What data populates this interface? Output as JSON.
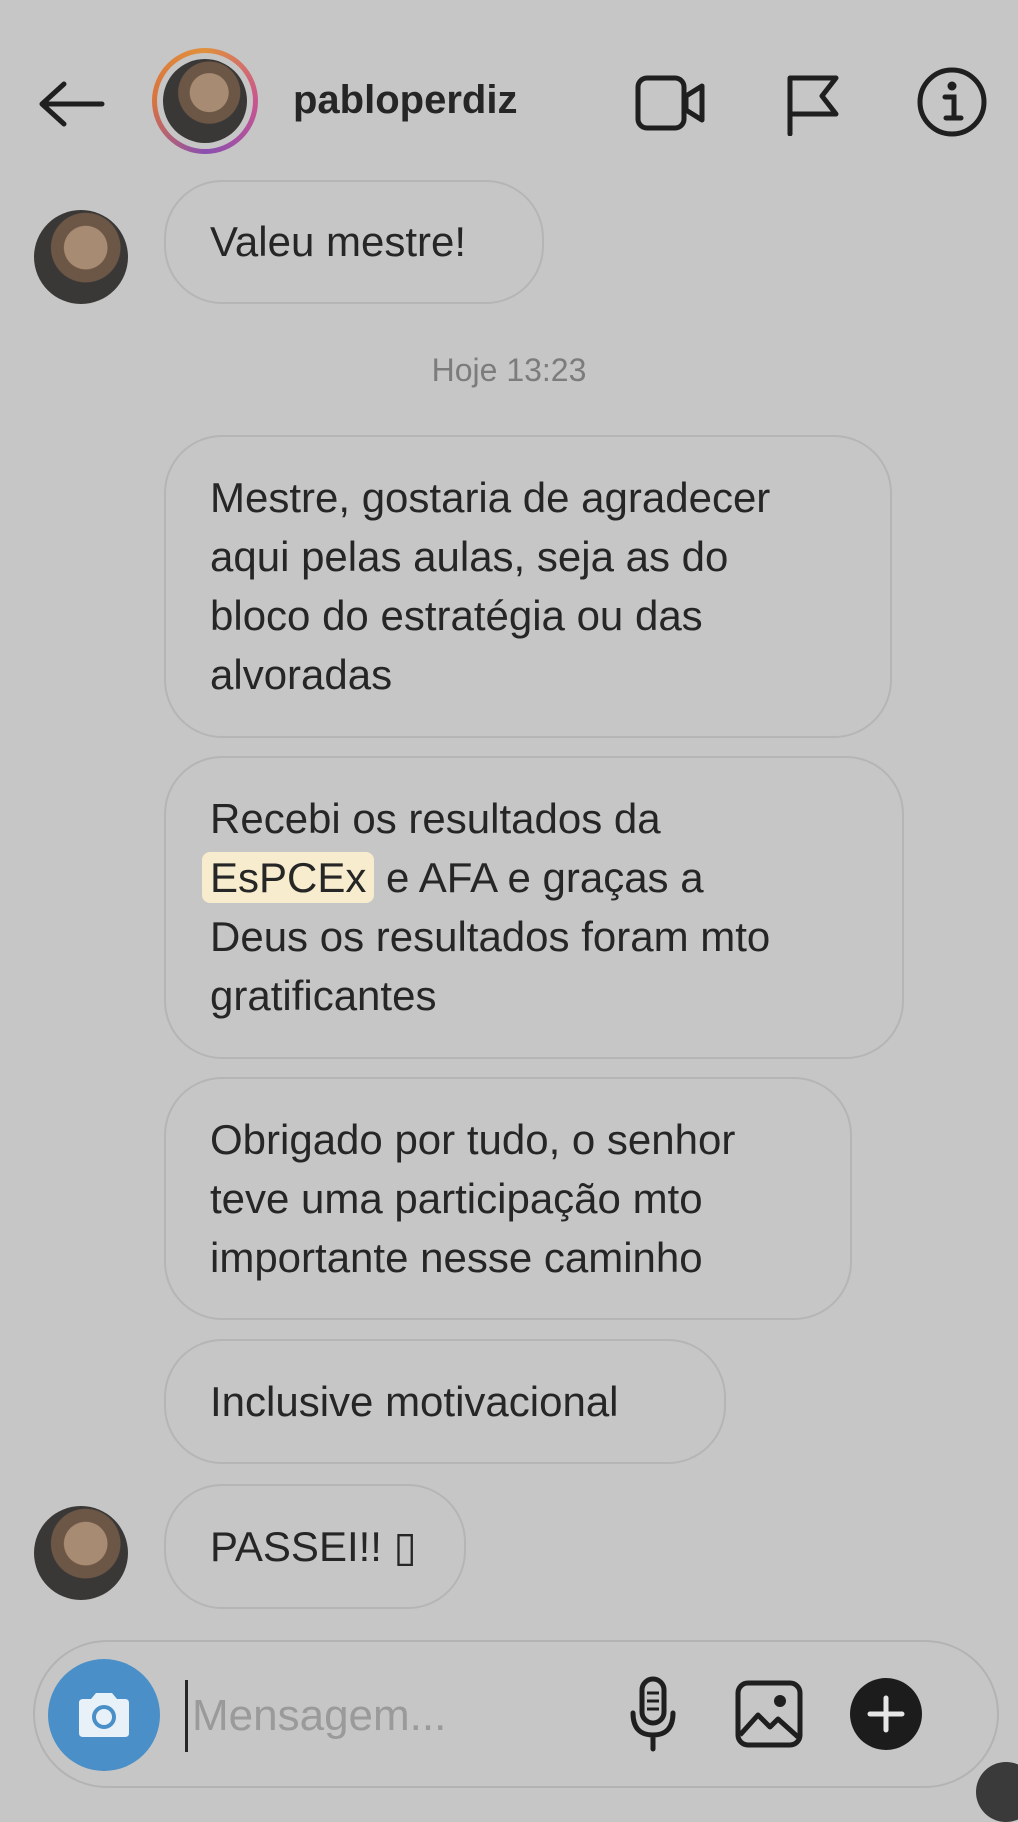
{
  "header": {
    "username": "pabloperdiz"
  },
  "icons": {
    "back": "arrow-left-icon",
    "video": "video-camera-icon",
    "report": "flag-icon",
    "info": "info-icon",
    "camera": "camera-icon",
    "mic": "microphone-icon",
    "gallery": "image-icon",
    "add": "plus-icon"
  },
  "conversation": {
    "timestamp": "Hoje 13:23",
    "messages": [
      {
        "lines": [
          "Valeu mestre!"
        ]
      },
      {
        "lines": [
          "Mestre, gostaria de agradecer",
          "aqui pelas aulas, seja as do",
          "bloco do estratégia ou das",
          "alvoradas"
        ]
      },
      {
        "line1": "Recebi os resultados da",
        "highlight": "EsPCEx",
        "line2_rest": " e AFA e graças a",
        "line3": "Deus os resultados foram mto",
        "line4": "gratificantes"
      },
      {
        "lines": [
          "Obrigado por tudo, o senhor",
          "teve uma participação mto",
          "importante nesse caminho"
        ]
      },
      {
        "lines": [
          "Inclusive motivacional"
        ]
      },
      {
        "lines": [
          "PASSEI!! ▯"
        ]
      }
    ]
  },
  "composer": {
    "placeholder": "Mensagem..."
  },
  "colors": {
    "background": "#c6c6c6",
    "camera_button": "#4a8fc7",
    "highlight": "#f7eccd",
    "text": "#262626"
  }
}
